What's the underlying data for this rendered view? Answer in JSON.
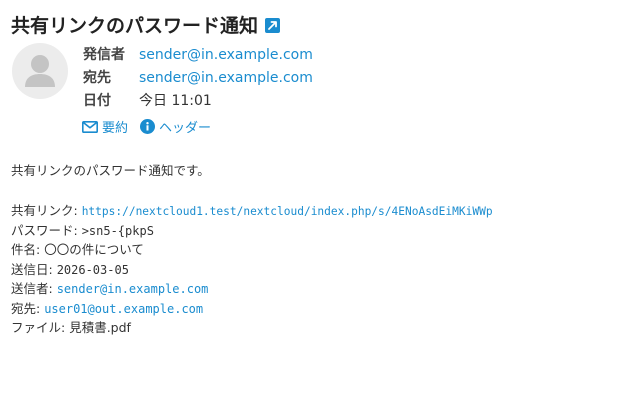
{
  "subject": "共有リンクのパスワード通知",
  "sender_meta": {
    "from_label": "発信者",
    "from_value": "sender@in.example.com",
    "to_label": "宛先",
    "to_value": "sender@in.example.com",
    "date_label": "日付",
    "date_value": "今日 11:01"
  },
  "actions": {
    "summary_label": "要約",
    "headers_label": "ヘッダー"
  },
  "message": {
    "intro": "共有リンクのパスワード通知です。",
    "share_link_label": "共有リンク: ",
    "share_link_value": "https://nextcloud1.test/nextcloud/index.php/s/4ENoAsdEiMKiWWp",
    "password_label": "パスワード: ",
    "password_value": ">sn5-{pkpS",
    "subject_label": "件名: ",
    "subject_value": "〇〇の件について",
    "sent_date_label": "送信日: ",
    "sent_date_value": "2026-03-05",
    "sender_label": "送信者: ",
    "sender_value": "sender@in.example.com",
    "recipient_label": "宛先: ",
    "recipient_value": "user01@out.example.com",
    "file_label": "ファイル: ",
    "file_value": "見積書.pdf"
  },
  "colors": {
    "link": "#1a8ccf",
    "text": "#333333",
    "avatar_bg": "#ececec",
    "avatar_fg": "#c4c4c4"
  },
  "icons": {
    "open": "external-link-icon",
    "summary": "envelope-icon",
    "headers": "info-icon",
    "avatar": "user-placeholder-icon"
  }
}
